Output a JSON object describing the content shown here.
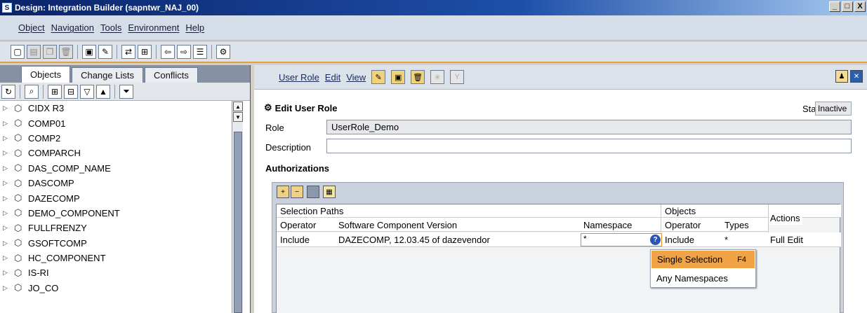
{
  "window": {
    "title": "Design: Integration Builder (sapntwr_NAJ_00)",
    "buttons": [
      "_",
      "□",
      "X"
    ]
  },
  "menu": [
    "Object",
    "Navigation",
    "Tools",
    "Environment",
    "Help"
  ],
  "left": {
    "tabs": [
      "Objects",
      "Change Lists",
      "Conflicts"
    ],
    "tree": [
      "CIDX R3",
      "COMP01",
      "COMP2",
      "COMPARCH",
      "DAS_COMP_NAME",
      "DASCOMP",
      "DAZECOMP",
      "DEMO_COMPONENT",
      "FULLFRENZY",
      "GSOFTCOMP",
      "HC_COMPONENT",
      "IS-RI",
      "JO_CO"
    ]
  },
  "right": {
    "menu": [
      "User Role",
      "Edit",
      "View"
    ],
    "heading": "Edit User Role",
    "status_label": "Status",
    "status_value": "Inactive",
    "role_label": "Role",
    "role_value": "UserRole_Demo",
    "description_label": "Description",
    "description_value": "",
    "authorizations_label": "Authorizations",
    "table": {
      "group_selection": "Selection Paths",
      "group_objects": "Objects",
      "actions": "Actions",
      "cols": [
        "Operator",
        "Software Component Version",
        "Namespace",
        "Operator",
        "Types"
      ],
      "row": {
        "operator": "Include",
        "scv": "DAZECOMP, 12.03.45 of dazevendor",
        "namespace": "*",
        "obj_operator": "Include",
        "types": "*",
        "actions": "Full Edit"
      }
    },
    "dropdown": [
      {
        "label": "Single Selection",
        "key": "F4"
      },
      {
        "label": "Any Namespaces",
        "key": ""
      }
    ]
  }
}
